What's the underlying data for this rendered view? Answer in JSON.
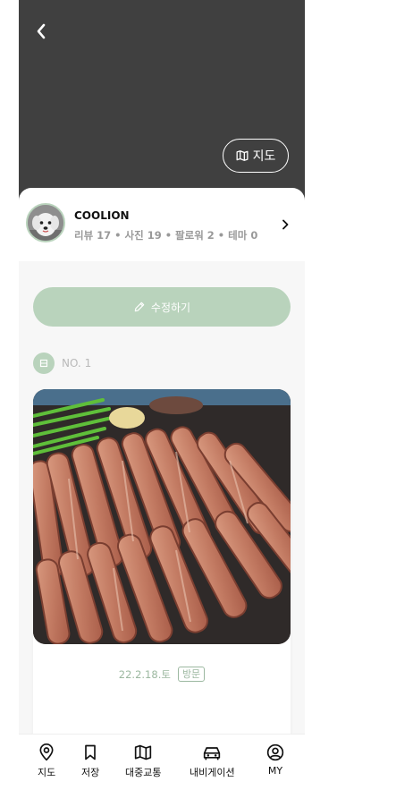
{
  "header": {
    "map_button_label": "지도"
  },
  "profile": {
    "username": "COOLION",
    "stats": "리뷰 17 • 사진 19 • 팔로워 2 • 테마 0"
  },
  "edit_button_label": "수정하기",
  "review": {
    "number_label": "NO. 1",
    "date": "22.2.18.토",
    "visit_tag": "방문"
  },
  "bottom_nav": [
    {
      "label": "지도",
      "icon": "map-pin-icon"
    },
    {
      "label": "저장",
      "icon": "bookmark-icon"
    },
    {
      "label": "대중교통",
      "icon": "map-icon"
    },
    {
      "label": "내비게이션",
      "icon": "car-icon"
    },
    {
      "label": "MY",
      "icon": "user-circle-icon"
    }
  ],
  "colors": {
    "header_bg": "#404040",
    "accent_green": "#b9d3bc",
    "tag_green": "#9cb8a0",
    "page_bg": "#f7f7f7"
  }
}
